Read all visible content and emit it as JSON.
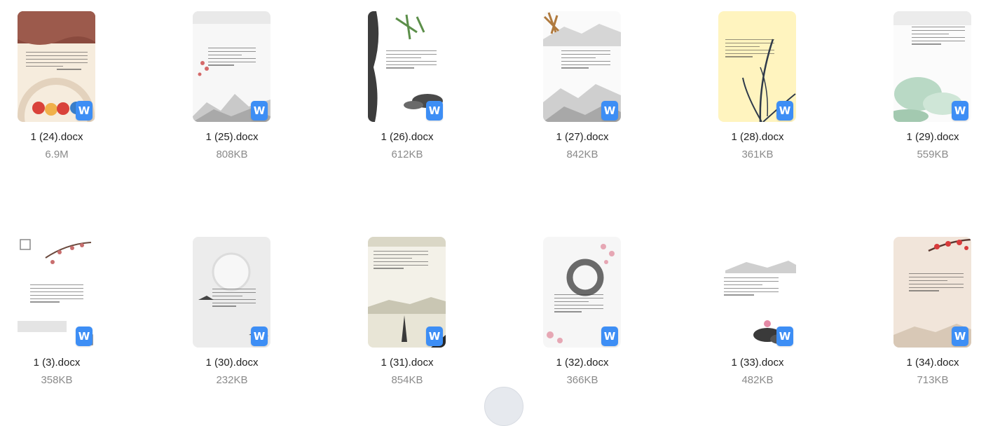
{
  "files": [
    {
      "name": "1 (24).docx",
      "size": "6.9M",
      "thumb": "kids-festival"
    },
    {
      "name": "1 (25).docx",
      "size": "808KB",
      "thumb": "ink-mountains-plum"
    },
    {
      "name": "1 (26).docx",
      "size": "612KB",
      "thumb": "ink-bamboo-dark"
    },
    {
      "name": "1 (27).docx",
      "size": "842KB",
      "thumb": "ink-mountains-bamboo"
    },
    {
      "name": "1 (28).docx",
      "size": "361KB",
      "thumb": "yellow-orchid"
    },
    {
      "name": "1 (29).docx",
      "size": "559KB",
      "thumb": "lotus-pond"
    },
    {
      "name": "1 (3).docx",
      "size": "358KB",
      "thumb": "plum-frame"
    },
    {
      "name": "1 (30).docx",
      "size": "232KB",
      "thumb": "grey-circle"
    },
    {
      "name": "1 (31).docx",
      "size": "854KB",
      "thumb": "lake-brush"
    },
    {
      "name": "1 (32).docx",
      "size": "366KB",
      "thumb": "ink-circle-plum"
    },
    {
      "name": "1 (33).docx",
      "size": "482KB",
      "thumb": "ink-lotus"
    },
    {
      "name": "1 (34).docx",
      "size": "713KB",
      "thumb": "plum-beige"
    }
  ],
  "badge_glyph": "W",
  "accent": "#3d8ef5"
}
